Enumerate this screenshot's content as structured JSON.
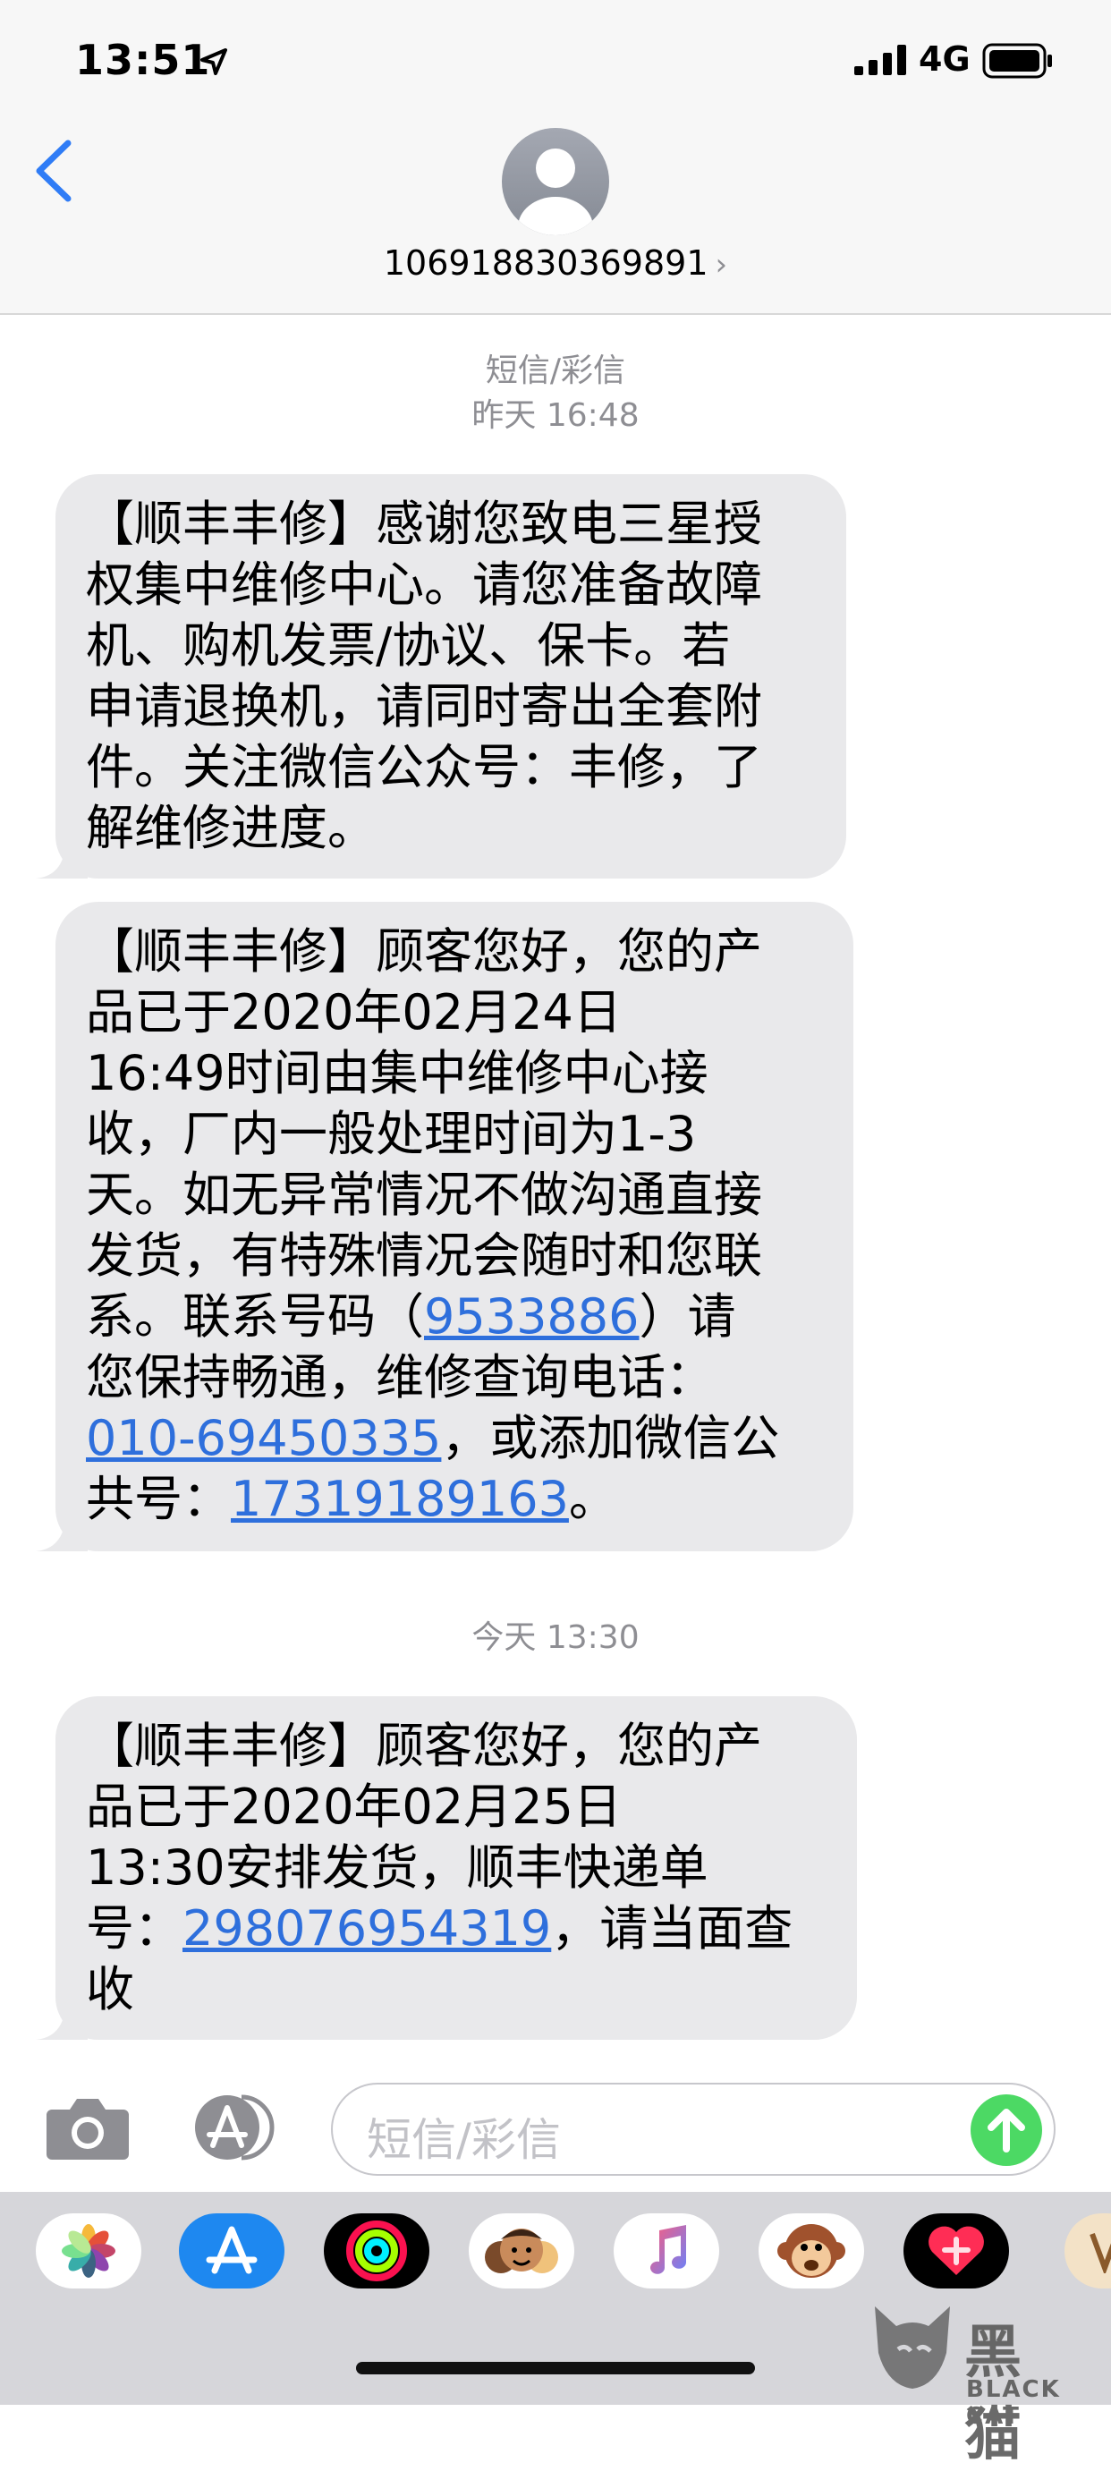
{
  "status_bar": {
    "time": "13:51",
    "network": "4G"
  },
  "header": {
    "contact": "106918830369891",
    "chevron": "›"
  },
  "thread": {
    "service_label": "短信/彩信",
    "stamp1": {
      "day": "昨天",
      "time": "16:48"
    },
    "stamp2": {
      "day": "今天",
      "time": "13:30"
    },
    "messages": [
      {
        "lines": [
          "【顺丰丰修】感谢您致电三星授",
          "权集中维修中心。请您准备故障",
          "机、购机发票/协议、保卡。若",
          "申请退换机，请同时寄出全套附",
          "件。关注微信公众号：丰修，了",
          "解维修进度。"
        ]
      },
      {
        "lines": [
          "【顺丰丰修】顾客您好，您的产",
          "品已于2020年02月24日",
          "16:49时间由集中维修中心接",
          "收，厂内一般处理时间为1-3",
          "天。如无异常情况不做沟通直接",
          "发货，有特殊情况会随时和您联"
        ],
        "line7_pre": "系。联系号码（",
        "line7_link": "9533886",
        "line7_post": "）请",
        "line8": "您保持畅通，维修查询电话：",
        "line9_link": "010-69450335",
        "line9_post": "，或添加微信公",
        "line10_pre": "共号：",
        "line10_link": "17319189163",
        "line10_post": "。"
      },
      {
        "lines": [
          "【顺丰丰修】顾客您好，您的产",
          "品已于2020年02月25日",
          "13:30安排发货，顺丰快递单"
        ],
        "line4_pre": "号：",
        "line4_link": "298076954319",
        "line4_post": "，请当面查",
        "line5": "收"
      }
    ]
  },
  "input": {
    "placeholder": "短信/彩信"
  },
  "drawer": {
    "apps": [
      "photos-icon",
      "app-store-icon",
      "activity-icon",
      "memoji-icon",
      "music-icon",
      "animoji-icon",
      "digital-touch-icon",
      "more-app-icon"
    ]
  },
  "watermark": {
    "title": "黑猫",
    "subtitle": "BLACK CAT"
  },
  "colors": {
    "bubble": "#e9e9eb",
    "link": "#2e6fdc",
    "accent": "#2f7cf6",
    "send": "#4cd964"
  }
}
